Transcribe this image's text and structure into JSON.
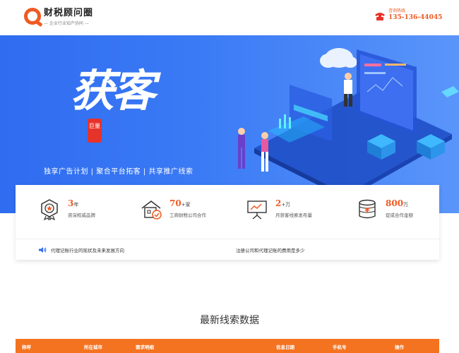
{
  "header": {
    "logo_title": "财税顾问圈",
    "logo_subtitle": "— 企业行业知产协同 —",
    "contact_label": "咨询热线",
    "contact_number": "135-136-44045"
  },
  "banner": {
    "title": "获客",
    "seal_text": "巨量",
    "slogan": "独享广告计划 | 聚合平台拓客 | 共享推广线索"
  },
  "stats": [
    {
      "value": "3",
      "unit": "年",
      "desc": "资深权威品牌",
      "icon": "medal-icon"
    },
    {
      "value": "70",
      "unit": "+家",
      "desc": "工商财税公司合作",
      "icon": "house-check-icon"
    },
    {
      "value": "2",
      "unit": "+万",
      "desc": "月获客线索发布量",
      "icon": "chart-board-icon"
    },
    {
      "value": "800",
      "unit": "万",
      "desc": "促成合作金额",
      "icon": "coin-stack-icon"
    }
  ],
  "news": [
    "代理记账行业的现状及未来发展方向",
    "注册公司和代理记账的费用是多少"
  ],
  "section": {
    "title": "最新线索数据"
  },
  "table": {
    "columns": [
      "称呼",
      "所在城市",
      "需求明细",
      "信息日期",
      "手机号",
      "操作"
    ]
  },
  "colors": {
    "accent": "#f05a23",
    "banner_blue": "#3b7bf5",
    "table_header": "#f47320"
  }
}
